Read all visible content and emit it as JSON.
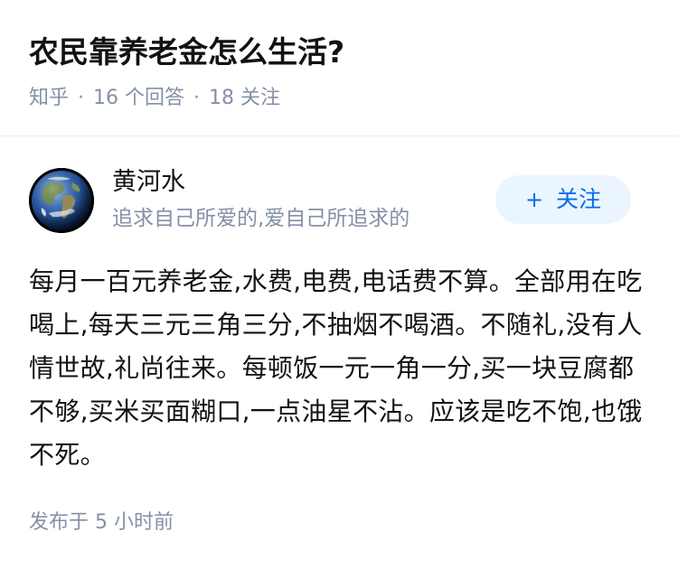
{
  "question": {
    "title": "农民靠养老金怎么生活?",
    "source": "知乎",
    "answers_count": "16",
    "answers_label": "个回答",
    "followers_count": "18",
    "followers_label": "关注",
    "separator": "·"
  },
  "answer": {
    "author": {
      "name": "黄河水",
      "bio": "追求自己所爱的,爱自己所追求的",
      "avatar_icon": "earth-globe-icon"
    },
    "follow_button": {
      "icon": "+",
      "label": "关注"
    },
    "content": "每月一百元养老金,水费,电费,电话费不算。全部用在吃喝上,每天三元三角三分,不抽烟不喝酒。不随礼,没有人情世故,礼尚往来。每顿饭一元一角一分,买一块豆腐都不够,买米买面糊口,一点油星不沾。应该是吃不饱,也饿不死。",
    "published": "发布于 5 小时前"
  },
  "colors": {
    "primary_text": "#121212",
    "secondary_text": "#8590a6",
    "accent": "#056de8",
    "follow_bg": "#ebf5ff",
    "divider": "#ebebeb"
  }
}
